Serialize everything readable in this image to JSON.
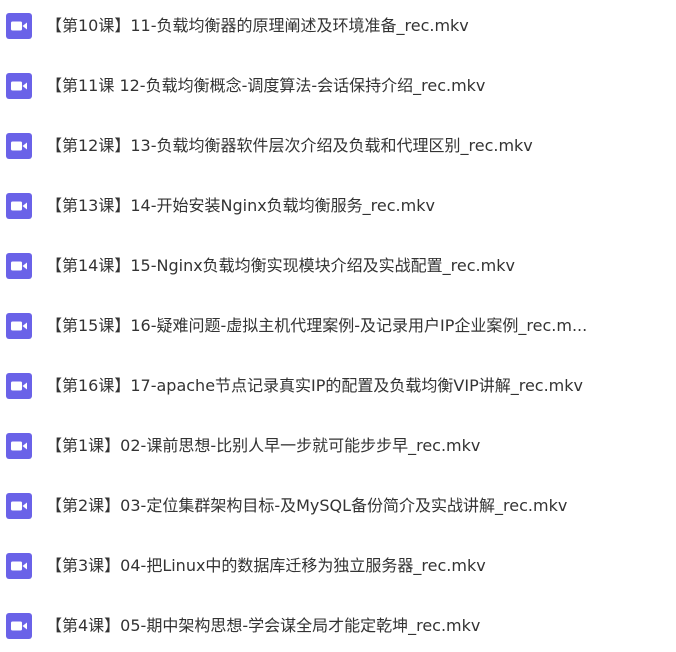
{
  "files": [
    {
      "name": "【第10课】11-负载均衡器的原理阐述及环境准备_rec.mkv",
      "icon": "video-file-icon"
    },
    {
      "name": "【第11课 12-负载均衡概念-调度算法-会话保持介绍_rec.mkv",
      "icon": "video-file-icon"
    },
    {
      "name": "【第12课】13-负载均衡器软件层次介绍及负载和代理区别_rec.mkv",
      "icon": "video-file-icon"
    },
    {
      "name": "【第13课】14-开始安装Nginx负载均衡服务_rec.mkv",
      "icon": "video-file-icon"
    },
    {
      "name": "【第14课】15-Nginx负载均衡实现模块介绍及实战配置_rec.mkv",
      "icon": "video-file-icon"
    },
    {
      "name": "【第15课】16-疑难问题-虚拟主机代理案例-及记录用户IP企业案例_rec.m...",
      "icon": "video-file-icon"
    },
    {
      "name": "【第16课】17-apache节点记录真实IP的配置及负载均衡VIP讲解_rec.mkv",
      "icon": "video-file-icon"
    },
    {
      "name": "【第1课】02-课前思想-比别人早一步就可能步步早_rec.mkv",
      "icon": "video-file-icon"
    },
    {
      "name": "【第2课】03-定位集群架构目标-及MySQL备份简介及实战讲解_rec.mkv",
      "icon": "video-file-icon"
    },
    {
      "name": "【第3课】04-把Linux中的数据库迁移为独立服务器_rec.mkv",
      "icon": "video-file-icon"
    },
    {
      "name": "【第4课】05-期中架构思想-学会谋全局才能定乾坤_rec.mkv",
      "icon": "video-file-icon"
    }
  ],
  "icon_color": "#6a62e8"
}
